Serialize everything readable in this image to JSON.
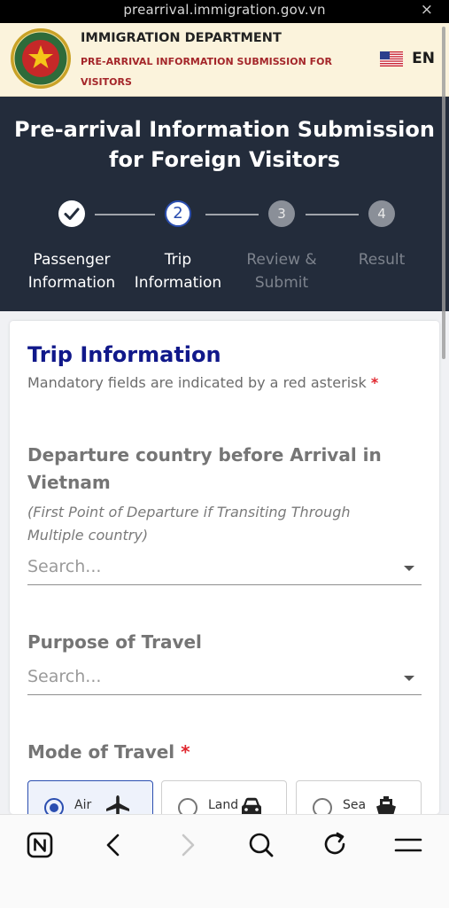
{
  "browser": {
    "url": "prearrival.immigration.gov.vn",
    "close_glyph": "×"
  },
  "header": {
    "title": "IMMIGRATION DEPARTMENT",
    "subtitle": "PRE-ARRIVAL INFORMATION SUBMISSION FOR VISITORS",
    "language_code": "EN",
    "emblem_icon": "immigration-emblem",
    "flag_icon": "us-flag-icon",
    "bg_color": "#fbf3dc",
    "subtitle_color": "#a4262a"
  },
  "banner": {
    "title_line1": "Pre-arrival Information Submission",
    "title_line2": "for Foreign Visitors",
    "bg_color": "#232c3b",
    "steps": [
      {
        "number": "✓",
        "label_line1": "Passenger",
        "label_line2": "Information",
        "state": "done"
      },
      {
        "number": "2",
        "label_line1": "Trip",
        "label_line2": "Information",
        "state": "current"
      },
      {
        "number": "3",
        "label_line1": "Review &",
        "label_line2": "Submit",
        "state": "todo"
      },
      {
        "number": "4",
        "label_line1": "Result",
        "label_line2": "",
        "state": "todo"
      }
    ]
  },
  "form": {
    "title": "Trip Information",
    "mandatory_note": "Mandatory fields are indicated by a red asterisk",
    "asterisk": "*",
    "departure": {
      "label_line1": "Departure country before Arrival in",
      "label_line2": "Vietnam",
      "hint_line1": "(First Point of Departure if Transiting Through",
      "hint_line2": "Multiple country)",
      "placeholder": "Search..."
    },
    "purpose": {
      "label": "Purpose of Travel",
      "placeholder": "Search..."
    },
    "mode": {
      "label": "Mode of Travel",
      "options": [
        {
          "label": "Air",
          "icon": "airplane-icon",
          "selected": true
        },
        {
          "label": "Land",
          "icon": "car-icon",
          "selected": false
        },
        {
          "label": "Sea",
          "icon": "ship-icon",
          "selected": false
        }
      ]
    },
    "title_color": "#10188a",
    "accent_color": "#2b4eb0",
    "required_color": "#e0262e"
  },
  "toolbar": {
    "items": [
      "app-logo-icon",
      "back-arrow-icon",
      "forward-arrow-icon",
      "search-icon",
      "reload-icon",
      "menu-icon"
    ]
  }
}
